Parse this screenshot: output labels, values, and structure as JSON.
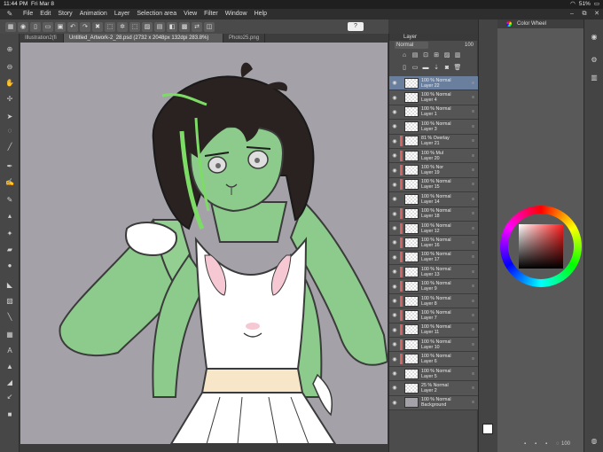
{
  "status": {
    "time": "11:44 PM",
    "date": "Fri Mar 8",
    "battery": "51%"
  },
  "menu": [
    "File",
    "Edit",
    "Story",
    "Animation",
    "Layer",
    "Selection area",
    "View",
    "Filter",
    "Window",
    "Help"
  ],
  "command_bar": {
    "help_label": "?"
  },
  "tabs": [
    {
      "label": "Illustration2(fi",
      "active": false
    },
    {
      "label": "Untitled_Artwork-2_28.psd (2732 x 2048px 132dpi 283.8%)",
      "active": true
    },
    {
      "label": "Photo25.png",
      "active": false
    }
  ],
  "layer_panel": {
    "title": "Layer",
    "blend_mode": "Normal",
    "opacity": "100",
    "layers": [
      {
        "pct": "100 %",
        "mode": "Normal",
        "name": "Layer 22",
        "selected": true,
        "clip": false
      },
      {
        "pct": "100 %",
        "mode": "Normal",
        "name": "Layer 4",
        "selected": false,
        "clip": false
      },
      {
        "pct": "100 %",
        "mode": "Normal",
        "name": "Layer 1",
        "selected": false,
        "clip": false
      },
      {
        "pct": "100 %",
        "mode": "Normal",
        "name": "Layer 3",
        "selected": false,
        "clip": false
      },
      {
        "pct": "81 %",
        "mode": "Overlay",
        "name": "Layer 21",
        "selected": false,
        "clip": true
      },
      {
        "pct": "100 %",
        "mode": "Mul",
        "name": "Layer 20",
        "selected": false,
        "clip": true
      },
      {
        "pct": "100 %",
        "mode": "Nor",
        "name": "Layer 19",
        "selected": false,
        "clip": true
      },
      {
        "pct": "100 %",
        "mode": "Normal",
        "name": "Layer 15",
        "selected": false,
        "clip": true
      },
      {
        "pct": "100 %",
        "mode": "Normal",
        "name": "Layer 14",
        "selected": false,
        "clip": false
      },
      {
        "pct": "100 %",
        "mode": "Normal",
        "name": "Layer 18",
        "selected": false,
        "clip": true
      },
      {
        "pct": "100 %",
        "mode": "Normal",
        "name": "Layer 12",
        "selected": false,
        "clip": true
      },
      {
        "pct": "100 %",
        "mode": "Normal",
        "name": "Layer 16",
        "selected": false,
        "clip": true
      },
      {
        "pct": "100 %",
        "mode": "Normal",
        "name": "Layer 17",
        "selected": false,
        "clip": true
      },
      {
        "pct": "100 %",
        "mode": "Normal",
        "name": "Layer 13",
        "selected": false,
        "clip": true
      },
      {
        "pct": "100 %",
        "mode": "Normal",
        "name": "Layer 9",
        "selected": false,
        "clip": true
      },
      {
        "pct": "100 %",
        "mode": "Normal",
        "name": "Layer 8",
        "selected": false,
        "clip": true
      },
      {
        "pct": "100 %",
        "mode": "Normal",
        "name": "Layer 7",
        "selected": false,
        "clip": true
      },
      {
        "pct": "100 %",
        "mode": "Normal",
        "name": "Layer 11",
        "selected": false,
        "clip": true
      },
      {
        "pct": "100 %",
        "mode": "Normal",
        "name": "Layer 10",
        "selected": false,
        "clip": true
      },
      {
        "pct": "100 %",
        "mode": "Normal",
        "name": "Layer 6",
        "selected": false,
        "clip": true
      },
      {
        "pct": "100 %",
        "mode": "Normal",
        "name": "Layer 5",
        "selected": false,
        "clip": false
      },
      {
        "pct": "25 %",
        "mode": "Normal",
        "name": "Layer 2",
        "selected": false,
        "clip": false
      },
      {
        "pct": "100 %",
        "mode": "Normal",
        "name": "Background",
        "selected": false,
        "clip": false,
        "bg": true
      }
    ]
  },
  "color_wheel": {
    "title": "Color Wheel",
    "bottom_value": "100"
  },
  "colors": {
    "canvas_bg": "#a4a2a8",
    "skin": "#8cc88c",
    "hair": "#2a2220",
    "hair_highlight": "#7ddc66",
    "dress": "#ffffff",
    "belt": "#f7e7c8",
    "selected_layer": "#6a7f9e"
  }
}
